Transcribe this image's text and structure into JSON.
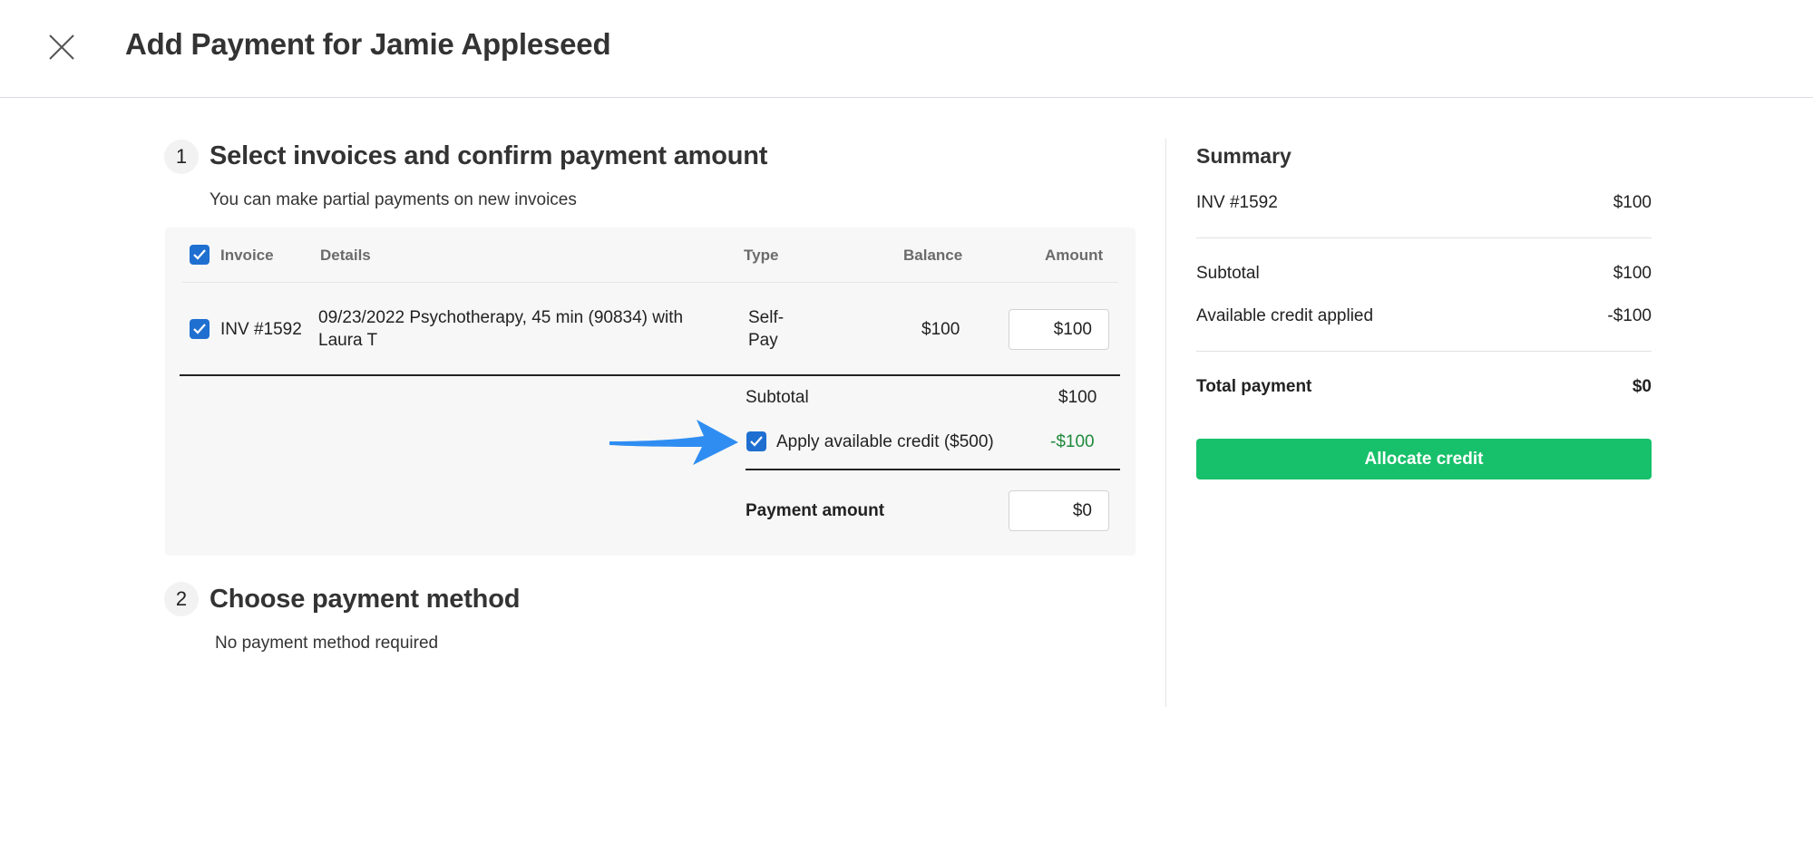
{
  "header": {
    "title": "Add Payment for Jamie Appleseed",
    "close_icon": "close-icon"
  },
  "step1": {
    "number": "1",
    "title": "Select invoices and confirm payment amount",
    "subtitle": "You can make partial payments on new invoices"
  },
  "table": {
    "headers": {
      "invoice": "Invoice",
      "details": "Details",
      "type": "Type",
      "balance": "Balance",
      "amount": "Amount"
    },
    "select_all_checked": true,
    "rows": [
      {
        "checked": true,
        "invoice": "INV #1592",
        "details_line1": "09/23/2022 Psychotherapy, 45 min (90834) with",
        "details_line2": "Laura T",
        "type_line1": "Self-",
        "type_line2": "Pay",
        "balance": "$100",
        "amount": "$100"
      }
    ]
  },
  "totals": {
    "subtotal_label": "Subtotal",
    "subtotal_value": "$100",
    "credit_checked": true,
    "credit_label": "Apply available credit ($500)",
    "credit_value": "-$100",
    "payment_label": "Payment amount",
    "payment_value": "$0"
  },
  "step2": {
    "number": "2",
    "title": "Choose payment method",
    "subtitle": "No payment method required"
  },
  "summary": {
    "title": "Summary",
    "invoice_label": "INV #1592",
    "invoice_value": "$100",
    "subtotal_label": "Subtotal",
    "subtotal_value": "$100",
    "credit_label": "Available credit applied",
    "credit_value": "-$100",
    "total_label": "Total payment",
    "total_value": "$0",
    "button_label": "Allocate credit"
  },
  "colors": {
    "checkbox": "#1f6fd1",
    "button": "#17c06a",
    "credit_text": "#1f8a3c",
    "arrow": "#2f8df2"
  }
}
